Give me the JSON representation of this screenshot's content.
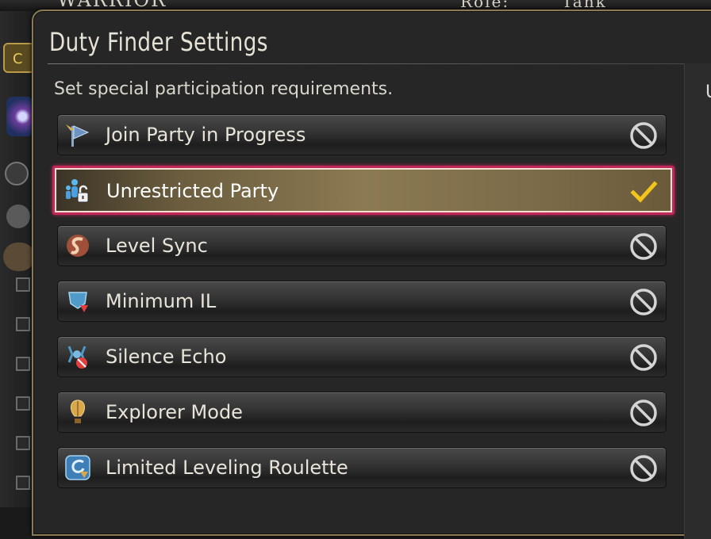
{
  "window": {
    "title": "Duty Finder Settings",
    "subtitle": "Set special participation requirements."
  },
  "background": {
    "job_name": "WARRIOR",
    "role_label": "Role:",
    "role_value": "Tank",
    "side_button": "C",
    "right_panel_letter": "U"
  },
  "options": [
    {
      "label": "Join Party in Progress",
      "icon": "join-party-flag-icon",
      "status": "disabled"
    },
    {
      "label": "Unrestricted Party",
      "icon": "unrestricted-party-lock-icon",
      "status": "checked"
    },
    {
      "label": "Level Sync",
      "icon": "level-sync-icon",
      "status": "disabled"
    },
    {
      "label": "Minimum IL",
      "icon": "minimum-item-level-icon",
      "status": "disabled"
    },
    {
      "label": "Silence Echo",
      "icon": "silence-echo-icon",
      "status": "disabled"
    },
    {
      "label": "Explorer Mode",
      "icon": "explorer-mode-balloon-icon",
      "status": "disabled"
    },
    {
      "label": "Limited Leveling Roulette",
      "icon": "limited-leveling-roulette-icon",
      "status": "disabled"
    }
  ],
  "colors": {
    "selection_border": "#c0285a",
    "check_color": "#f2c51a",
    "frame_gold": "#8a7a55"
  }
}
